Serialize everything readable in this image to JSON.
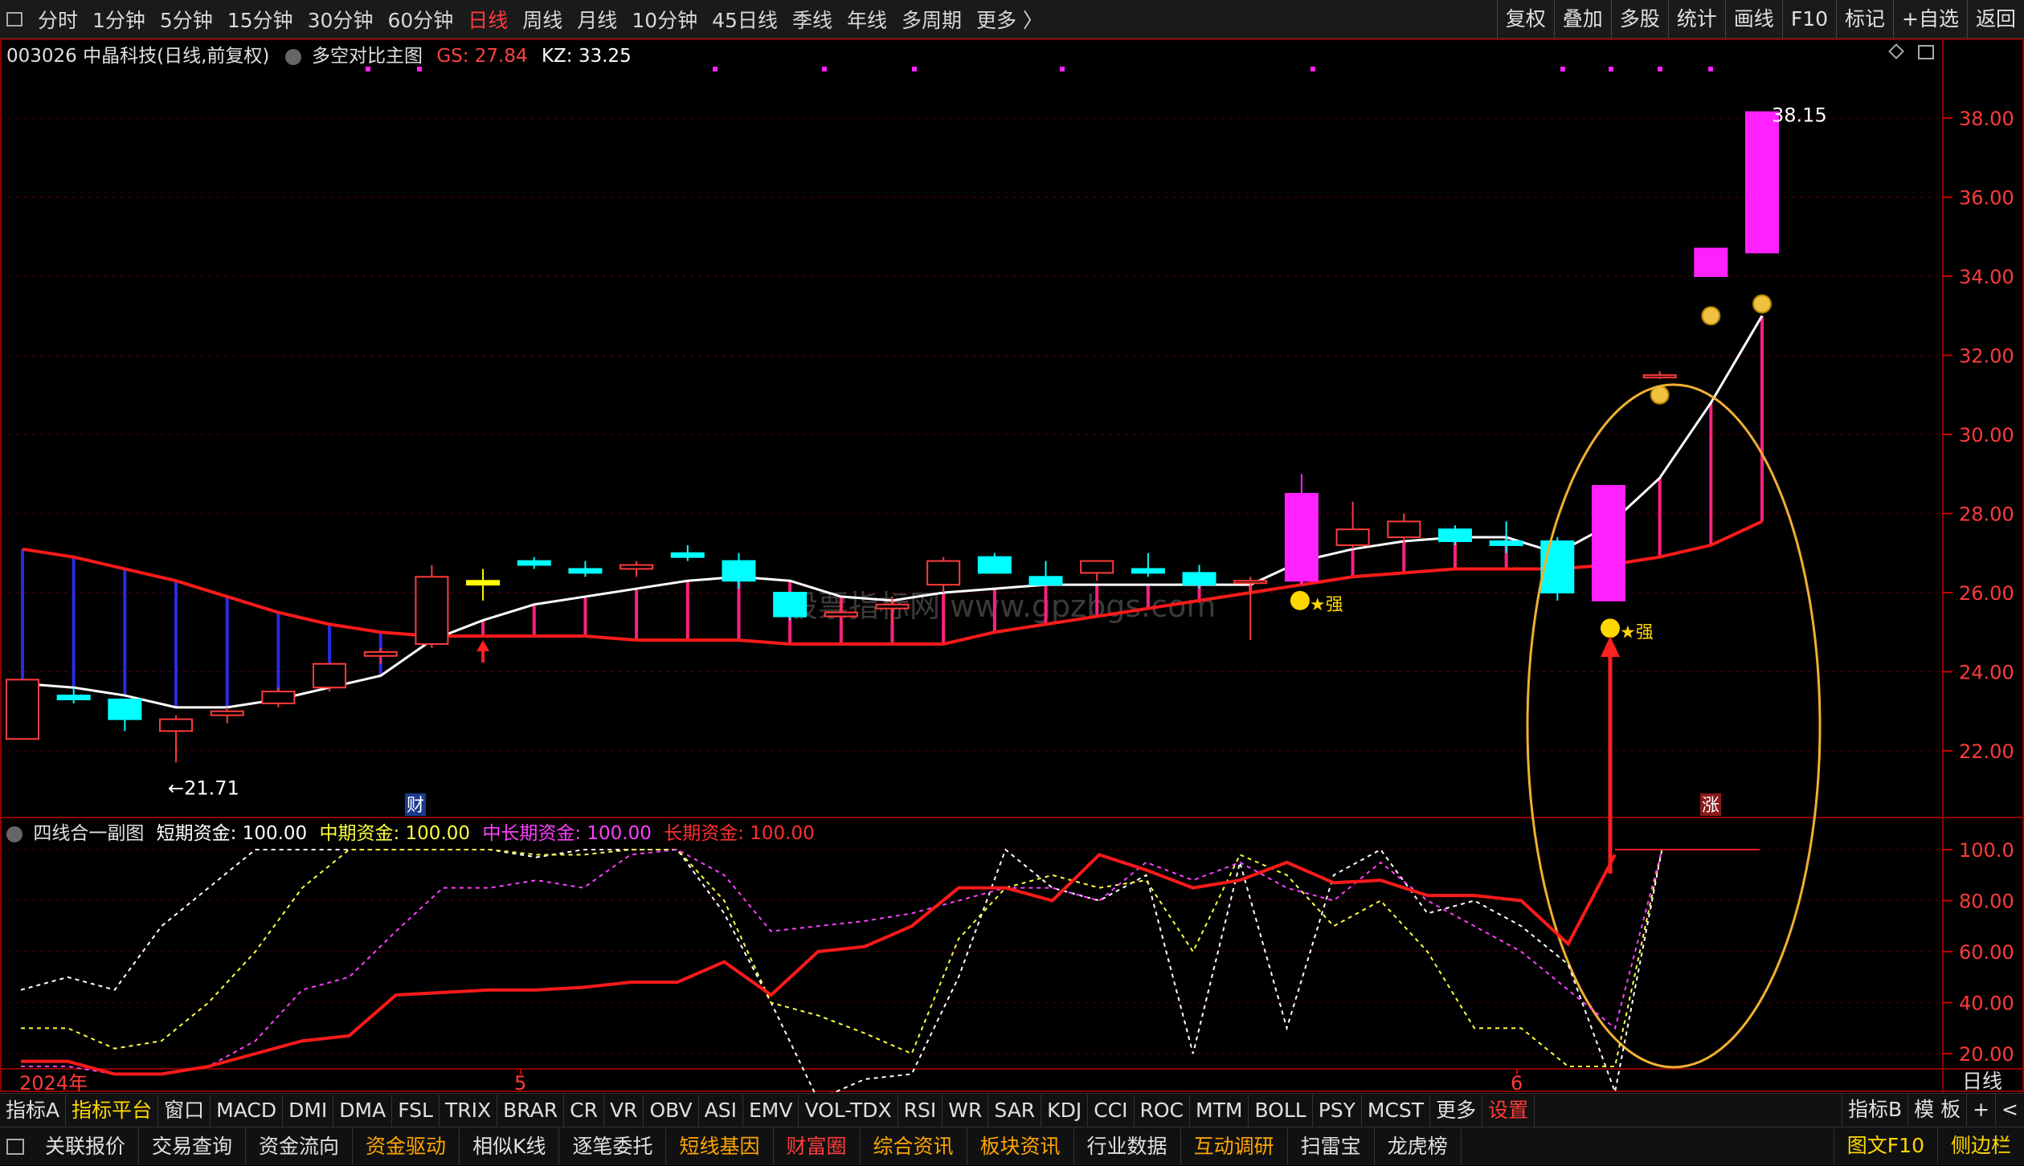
{
  "periods": [
    "分时",
    "1分钟",
    "5分钟",
    "15分钟",
    "30分钟",
    "60分钟",
    "日线",
    "周线",
    "月线",
    "10分钟",
    "45日线",
    "季线",
    "年线",
    "多周期",
    "更多 〉"
  ],
  "active_period": "日线",
  "top_right": [
    "复权",
    "叠加",
    "多股",
    "统计",
    "画线",
    "F10",
    "标记",
    "+自选",
    "返回"
  ],
  "main": {
    "stock": "003026 中晶科技(日线,前复权)",
    "indicator": "多空对比主图",
    "gs": "GS: 27.84",
    "kz": "KZ: 33.25",
    "high_label": "38.15",
    "low_label": "←21.71",
    "strong_label_1": "★强",
    "strong_label_2": "★强",
    "cai_label": "财",
    "zhang_label": "涨"
  },
  "sub": {
    "indicator": "四线合一副图",
    "short": "短期资金: 100.00",
    "mid": "中期资金: 100.00",
    "midlong": "中长期资金: 100.00",
    "long": "长期资金: 100.00"
  },
  "axis": {
    "main_ticks": [
      "38.00",
      "36.00",
      "34.00",
      "32.00",
      "30.00",
      "28.00",
      "26.00",
      "24.00",
      "22.00"
    ],
    "sub_ticks": [
      "100.0",
      "80.00",
      "60.00",
      "40.00",
      "20.00"
    ],
    "date_labels": [
      "2024年",
      "5",
      "6"
    ],
    "period_label": "日线"
  },
  "colors": {
    "up": "#ff3b3b",
    "down": "#00ffff",
    "magenta": "#ff22ff",
    "red_line": "#ff1a1a",
    "white_line": "#ffffff",
    "grid": "#5a0000",
    "ellipse": "#f0b030"
  },
  "indicator_tabs": [
    "指标A",
    "指标平台",
    "窗口",
    "MACD",
    "DMI",
    "DMA",
    "FSL",
    "TRIX",
    "BRAR",
    "CR",
    "VR",
    "OBV",
    "ASI",
    "EMV",
    "VOL-TDX",
    "RSI",
    "WR",
    "SAR",
    "KDJ",
    "CCI",
    "ROC",
    "MTM",
    "BOLL",
    "PSY",
    "MCST",
    "更多",
    "设置"
  ],
  "indicator_right": [
    "指标B",
    "模 板",
    "+",
    "<"
  ],
  "bottom_tabs": [
    "关联报价",
    "交易查询",
    "资金流向",
    "资金驱动",
    "相似K线",
    "逐笔委托",
    "短线基因",
    "财富圈",
    "综合资讯",
    "板块资讯",
    "行业数据",
    "互动调研",
    "扫雷宝",
    "龙虎榜"
  ],
  "bottom_right": [
    "图文F10",
    "侧边栏"
  ],
  "watermark": "股票指标网 www.gpzbgs.com",
  "chart_data": [
    {
      "type": "candlestick",
      "title": "003026 中晶科技(日线,前复权)",
      "ylim": [
        21,
        38.6
      ],
      "candles": [
        {
          "o": 22.3,
          "h": 23.8,
          "l": 22.3,
          "c": 23.8
        },
        {
          "o": 23.4,
          "h": 23.6,
          "l": 23.2,
          "c": 23.3
        },
        {
          "o": 23.3,
          "h": 23.3,
          "l": 22.5,
          "c": 22.8
        },
        {
          "o": 22.5,
          "h": 22.9,
          "l": 21.71,
          "c": 22.8
        },
        {
          "o": 22.9,
          "h": 23.1,
          "l": 22.7,
          "c": 23.0
        },
        {
          "o": 23.2,
          "h": 23.6,
          "l": 23.1,
          "c": 23.5
        },
        {
          "o": 23.6,
          "h": 24.2,
          "l": 23.5,
          "c": 24.2
        },
        {
          "o": 24.4,
          "h": 24.6,
          "l": 24.2,
          "c": 24.5
        },
        {
          "o": 24.7,
          "h": 26.7,
          "l": 24.6,
          "c": 26.4
        },
        {
          "o": 26.2,
          "h": 26.6,
          "l": 25.8,
          "c": 26.3
        },
        {
          "o": 26.8,
          "h": 26.9,
          "l": 26.6,
          "c": 26.7
        },
        {
          "o": 26.6,
          "h": 26.8,
          "l": 26.4,
          "c": 26.5
        },
        {
          "o": 26.6,
          "h": 26.8,
          "l": 26.4,
          "c": 26.7
        },
        {
          "o": 27.0,
          "h": 27.2,
          "l": 26.8,
          "c": 26.9
        },
        {
          "o": 26.8,
          "h": 27.0,
          "l": 26.1,
          "c": 26.3
        },
        {
          "o": 26.0,
          "h": 26.0,
          "l": 25.3,
          "c": 25.4
        },
        {
          "o": 25.4,
          "h": 25.8,
          "l": 25.2,
          "c": 25.5
        },
        {
          "o": 25.6,
          "h": 25.9,
          "l": 25.2,
          "c": 25.7
        },
        {
          "o": 26.2,
          "h": 26.9,
          "l": 26.0,
          "c": 26.8
        },
        {
          "o": 26.9,
          "h": 27.0,
          "l": 26.5,
          "c": 26.5
        },
        {
          "o": 26.4,
          "h": 26.8,
          "l": 26.2,
          "c": 26.2
        },
        {
          "o": 26.5,
          "h": 26.8,
          "l": 26.3,
          "c": 26.8
        },
        {
          "o": 26.6,
          "h": 27.0,
          "l": 26.4,
          "c": 26.5
        },
        {
          "o": 26.5,
          "h": 26.7,
          "l": 26.1,
          "c": 26.2
        },
        {
          "o": 26.3,
          "h": 26.4,
          "l": 24.8,
          "c": 26.3
        },
        {
          "o": 26.3,
          "h": 29.0,
          "l": 26.2,
          "c": 28.5
        },
        {
          "o": 27.2,
          "h": 28.3,
          "l": 27.1,
          "c": 27.6
        },
        {
          "o": 27.4,
          "h": 28.0,
          "l": 27.2,
          "c": 27.8
        },
        {
          "o": 27.6,
          "h": 27.7,
          "l": 27.2,
          "c": 27.3
        },
        {
          "o": 27.3,
          "h": 27.8,
          "l": 27.0,
          "c": 27.2
        },
        {
          "o": 27.3,
          "h": 27.4,
          "l": 25.8,
          "c": 26.0
        },
        {
          "o": 25.8,
          "h": 28.7,
          "l": 25.8,
          "c": 28.7
        },
        {
          "o": 31.5,
          "h": 31.6,
          "l": 31.4,
          "c": 31.5
        },
        {
          "o": 34.0,
          "h": 34.7,
          "l": 34.0,
          "c": 34.7
        },
        {
          "o": 34.6,
          "h": 38.15,
          "l": 34.6,
          "c": 38.15
        }
      ],
      "lines": [
        {
          "name": "white",
          "values": [
            23.7,
            23.6,
            23.4,
            23.1,
            23.1,
            23.3,
            23.6,
            23.9,
            24.8,
            25.3,
            25.7,
            25.9,
            26.1,
            26.3,
            26.4,
            26.3,
            25.9,
            25.8,
            26.0,
            26.1,
            26.2,
            26.2,
            26.2,
            26.2,
            26.2,
            26.8,
            27.1,
            27.3,
            27.4,
            27.4,
            27.0,
            27.7,
            28.9,
            30.8,
            33.0
          ]
        },
        {
          "name": "red",
          "values": [
            27.1,
            26.9,
            26.6,
            26.3,
            25.9,
            25.5,
            25.2,
            25.0,
            24.9,
            24.9,
            24.9,
            24.9,
            24.8,
            24.8,
            24.8,
            24.7,
            24.7,
            24.7,
            24.7,
            25.0,
            25.2,
            25.4,
            25.6,
            25.8,
            26.0,
            26.2,
            26.4,
            26.5,
            26.6,
            26.6,
            26.6,
            26.7,
            26.9,
            27.2,
            27.8
          ]
        }
      ]
    },
    {
      "type": "line",
      "title": "四线合一副图",
      "ylim": [
        10,
        105
      ],
      "series": [
        {
          "name": "短期资金",
          "values": [
            45,
            50,
            45,
            70,
            85,
            100,
            100,
            100,
            100,
            100,
            100,
            97,
            100,
            100,
            100,
            75,
            40,
            2,
            10,
            12,
            50,
            100,
            85,
            80,
            90,
            20,
            95,
            30,
            90,
            100,
            75,
            80,
            70,
            55,
            5,
            100
          ]
        },
        {
          "name": "中期资金",
          "values": [
            30,
            30,
            22,
            25,
            40,
            60,
            85,
            100,
            100,
            100,
            100,
            98,
            98,
            100,
            100,
            80,
            40,
            35,
            28,
            20,
            65,
            85,
            90,
            85,
            88,
            60,
            98,
            90,
            70,
            80,
            60,
            30,
            30,
            15,
            15,
            100
          ]
        },
        {
          "name": "中长期资金",
          "values": [
            15,
            15,
            12,
            12,
            15,
            25,
            45,
            50,
            68,
            85,
            85,
            88,
            85,
            98,
            100,
            90,
            68,
            70,
            72,
            75,
            80,
            85,
            85,
            80,
            95,
            88,
            95,
            85,
            80,
            95,
            80,
            70,
            60,
            45,
            30,
            100
          ]
        },
        {
          "name": "长期资金",
          "values": [
            17,
            17,
            12,
            12,
            15,
            20,
            25,
            27,
            43,
            44,
            45,
            45,
            46,
            48,
            48,
            56,
            43,
            60,
            62,
            70,
            85,
            85,
            80,
            98,
            92,
            85,
            88,
            95,
            87,
            88,
            82,
            82,
            80,
            63,
            98
          ]
        }
      ]
    }
  ]
}
